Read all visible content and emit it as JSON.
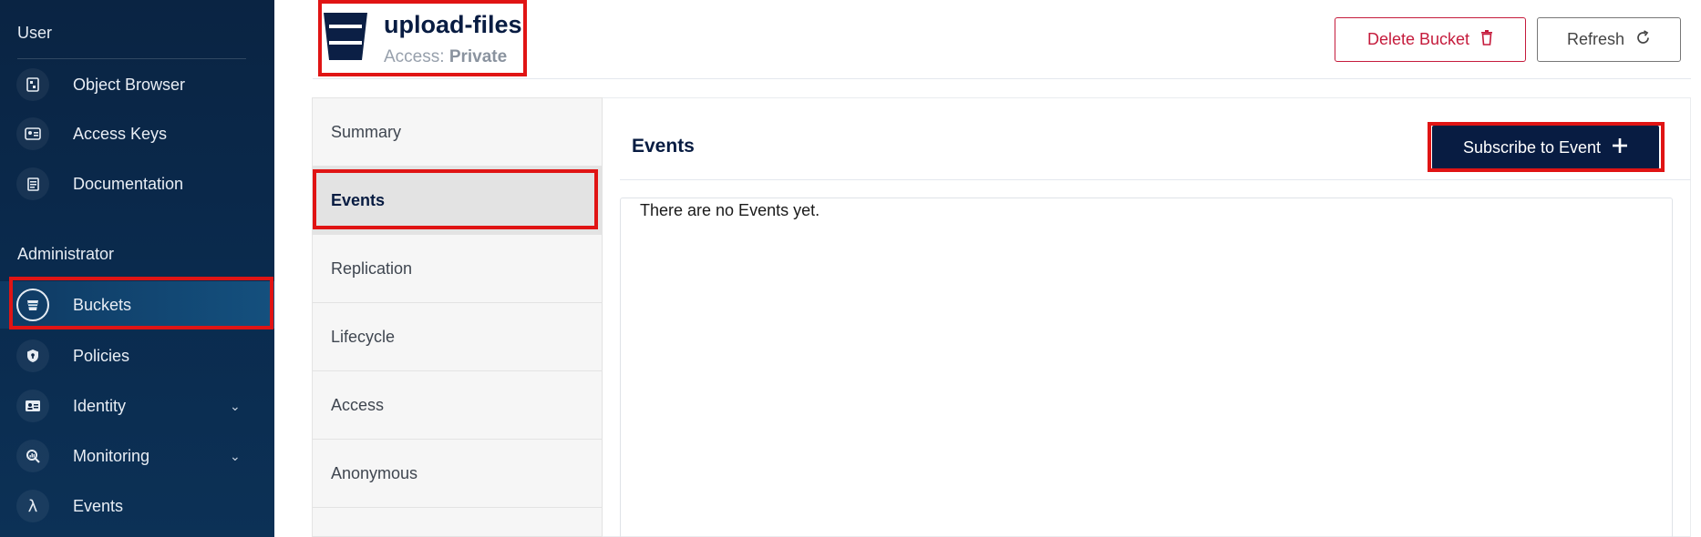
{
  "sidebar": {
    "user_section": "User",
    "admin_section": "Administrator",
    "user_items": [
      {
        "label": "Object Browser",
        "icon": "object-browser-icon"
      },
      {
        "label": "Access Keys",
        "icon": "access-keys-icon"
      },
      {
        "label": "Documentation",
        "icon": "documentation-icon"
      }
    ],
    "admin_items": [
      {
        "label": "Buckets",
        "icon": "bucket-icon",
        "active": true
      },
      {
        "label": "Policies",
        "icon": "shield-icon"
      },
      {
        "label": "Identity",
        "icon": "id-card-icon",
        "has_chevron": true
      },
      {
        "label": "Monitoring",
        "icon": "monitoring-icon",
        "has_chevron": true
      },
      {
        "label": "Events",
        "icon": "lambda-icon"
      }
    ]
  },
  "header": {
    "bucket_name": "upload-files",
    "access_label": "Access:",
    "access_value": "Private",
    "delete_label": "Delete Bucket",
    "refresh_label": "Refresh"
  },
  "tabs": [
    {
      "label": "Summary"
    },
    {
      "label": "Events",
      "active": true
    },
    {
      "label": "Replication"
    },
    {
      "label": "Lifecycle"
    },
    {
      "label": "Access"
    },
    {
      "label": "Anonymous"
    }
  ],
  "content": {
    "title": "Events",
    "subscribe_label": "Subscribe to Event",
    "empty_message": "There are no Events yet."
  },
  "colors": {
    "sidebar_bg": "#0a2443",
    "primary": "#081c42",
    "danger": "#c51b3c",
    "highlight": "#e01414"
  }
}
